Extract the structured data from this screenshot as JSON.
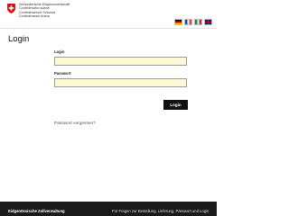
{
  "header": {
    "confederation_lines": [
      "Schweizerische Eidgenossenschaft",
      "Confédération suisse",
      "Confederazione Svizzera",
      "Confederaziun svizra"
    ],
    "languages": [
      "de",
      "fr",
      "it",
      "en"
    ]
  },
  "login": {
    "title": "Login",
    "username_label": "Login",
    "username_value": "",
    "password_label": "Passwort",
    "password_value": "",
    "submit_label": "Login",
    "forgot_label": "Passwort vergessen?"
  },
  "footer": {
    "org": "Eidgenössische Zollverwaltung",
    "help_text": "Für Fragen zur Bestellung, Lieferung, Passwort und Login"
  },
  "colors": {
    "input_background": "#fcf9d7",
    "button": "#111111",
    "footer": "#1a1a1a",
    "swiss_red": "#e30613"
  }
}
